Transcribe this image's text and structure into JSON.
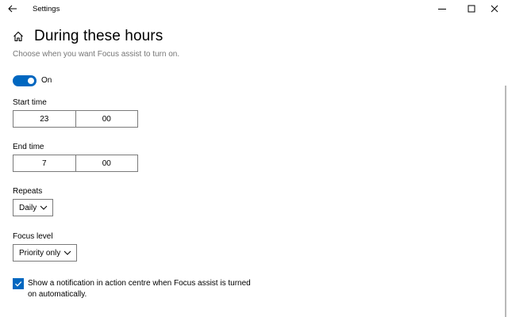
{
  "window": {
    "title": "Settings"
  },
  "header": {
    "title": "During these hours",
    "subtitle": "Choose when you want Focus assist to turn on."
  },
  "toggle": {
    "state": "on",
    "label": "On",
    "color": "#0067c0"
  },
  "start_time": {
    "label": "Start time",
    "hour": "23",
    "minute": "00"
  },
  "end_time": {
    "label": "End time",
    "hour": "7",
    "minute": "00"
  },
  "repeats": {
    "label": "Repeats",
    "selected": "Daily"
  },
  "focus_level": {
    "label": "Focus level",
    "selected": "Priority only"
  },
  "notification": {
    "checked": true,
    "label": "Show a notification in action centre when Focus assist is turned on automatically."
  },
  "icons": {
    "back": "back-arrow-icon",
    "home": "home-icon",
    "minimize": "minimize-icon",
    "maximize": "maximize-icon",
    "close": "close-icon",
    "chevron": "chevron-down-icon",
    "check": "checkmark-icon"
  }
}
